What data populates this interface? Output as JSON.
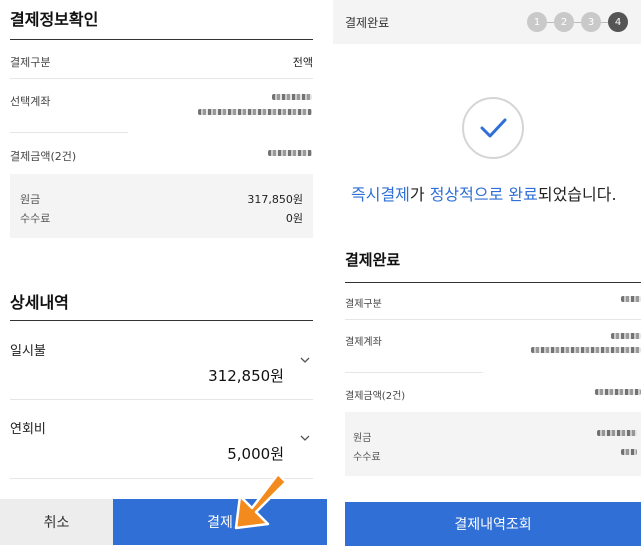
{
  "left": {
    "title": "결제정보확인",
    "payment_type": {
      "label": "결제구분",
      "value": "전액"
    },
    "selected_account": {
      "label": "선택계좌"
    },
    "payment_amount": {
      "label": "결제금액(2건)"
    },
    "breakdown": {
      "principal_label": "원금",
      "principal_value": "317,850원",
      "fee_label": "수수료",
      "fee_value": "0원"
    },
    "details": {
      "title": "상세내역",
      "items": [
        {
          "name": "일시불",
          "amount": "312,850원"
        },
        {
          "name": "연회비",
          "amount": "5,000원"
        }
      ]
    },
    "cancel_label": "취소",
    "pay_label": "결제"
  },
  "right": {
    "header_title": "결제완료",
    "steps": [
      "1",
      "2",
      "3",
      "4"
    ],
    "active_step": 4,
    "message": {
      "part1": "즉시결제",
      "part2": "가 ",
      "part3": "정상적으로",
      "part4": " ",
      "part5": "완료",
      "part6": "되었습니다."
    },
    "section_title": "결제완료",
    "payment_type_label": "결제구분",
    "account_label": "결제계좌",
    "amount_label": "결제금액(2건)",
    "principal_label": "원금",
    "fee_label": "수수료",
    "history_button_label": "결제내역조회"
  },
  "colors": {
    "accent": "#2f6fd6",
    "arrow": "#f28a1e"
  }
}
